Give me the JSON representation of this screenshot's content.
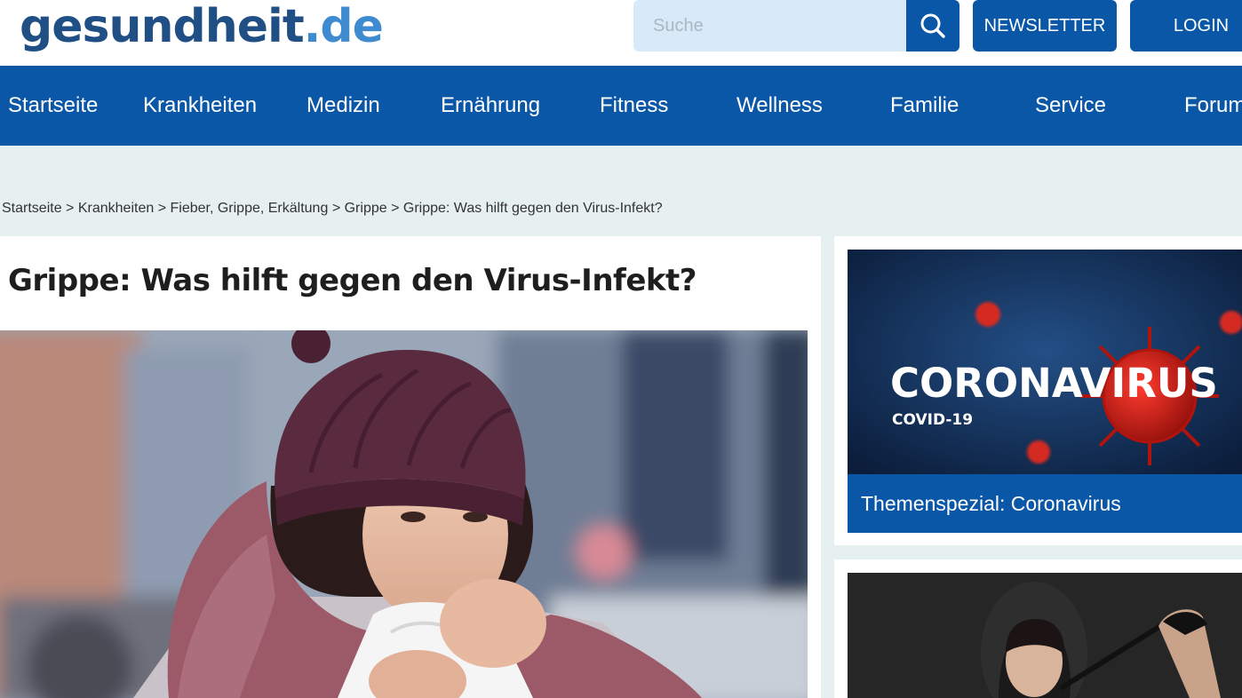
{
  "header": {
    "logo_main": "gesundheit",
    "logo_tld": ".de",
    "search_placeholder": "Suche",
    "newsletter_label": "NEWSLETTER",
    "login_label": "LOGIN"
  },
  "nav": {
    "items": [
      {
        "label": "Startseite"
      },
      {
        "label": "Krankheiten"
      },
      {
        "label": "Medizin"
      },
      {
        "label": "Ernährung"
      },
      {
        "label": "Fitness"
      },
      {
        "label": "Wellness"
      },
      {
        "label": "Familie"
      },
      {
        "label": "Service"
      },
      {
        "label": "Forum"
      }
    ]
  },
  "breadcrumb": {
    "items": [
      "Startseite",
      "Krankheiten",
      "Fieber, Grippe, Erkältung",
      "Grippe",
      "Grippe: Was hilft gegen den Virus-Infekt?"
    ],
    "separator": ">"
  },
  "article": {
    "title": "Grippe: Was hilft gegen den Virus-Infekt?"
  },
  "sidebar": {
    "teaser1": {
      "image_text": "CORONAVIRUS",
      "image_subtext": "COVID-19",
      "caption": "Themenspezial: Coronavirus"
    }
  },
  "colors": {
    "brand_blue": "#0a57a8",
    "logo_dark": "#1f4f85",
    "logo_light": "#3f8bd0",
    "page_bg": "#e6f0f0"
  },
  "icons": {
    "search": "search-icon"
  }
}
